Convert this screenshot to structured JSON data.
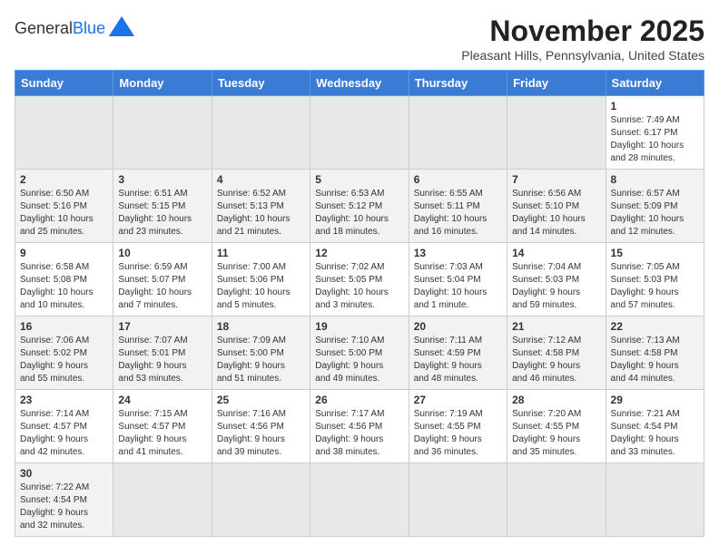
{
  "header": {
    "logo_general": "General",
    "logo_blue": "Blue",
    "month_year": "November 2025",
    "location": "Pleasant Hills, Pennsylvania, United States"
  },
  "days_of_week": [
    "Sunday",
    "Monday",
    "Tuesday",
    "Wednesday",
    "Thursday",
    "Friday",
    "Saturday"
  ],
  "weeks": [
    [
      {
        "day": "",
        "text": ""
      },
      {
        "day": "",
        "text": ""
      },
      {
        "day": "",
        "text": ""
      },
      {
        "day": "",
        "text": ""
      },
      {
        "day": "",
        "text": ""
      },
      {
        "day": "",
        "text": ""
      },
      {
        "day": "1",
        "text": "Sunrise: 7:49 AM\nSunset: 6:17 PM\nDaylight: 10 hours\nand 28 minutes."
      }
    ],
    [
      {
        "day": "2",
        "text": "Sunrise: 6:50 AM\nSunset: 5:16 PM\nDaylight: 10 hours\nand 25 minutes."
      },
      {
        "day": "3",
        "text": "Sunrise: 6:51 AM\nSunset: 5:15 PM\nDaylight: 10 hours\nand 23 minutes."
      },
      {
        "day": "4",
        "text": "Sunrise: 6:52 AM\nSunset: 5:13 PM\nDaylight: 10 hours\nand 21 minutes."
      },
      {
        "day": "5",
        "text": "Sunrise: 6:53 AM\nSunset: 5:12 PM\nDaylight: 10 hours\nand 18 minutes."
      },
      {
        "day": "6",
        "text": "Sunrise: 6:55 AM\nSunset: 5:11 PM\nDaylight: 10 hours\nand 16 minutes."
      },
      {
        "day": "7",
        "text": "Sunrise: 6:56 AM\nSunset: 5:10 PM\nDaylight: 10 hours\nand 14 minutes."
      },
      {
        "day": "8",
        "text": "Sunrise: 6:57 AM\nSunset: 5:09 PM\nDaylight: 10 hours\nand 12 minutes."
      }
    ],
    [
      {
        "day": "9",
        "text": "Sunrise: 6:58 AM\nSunset: 5:08 PM\nDaylight: 10 hours\nand 10 minutes."
      },
      {
        "day": "10",
        "text": "Sunrise: 6:59 AM\nSunset: 5:07 PM\nDaylight: 10 hours\nand 7 minutes."
      },
      {
        "day": "11",
        "text": "Sunrise: 7:00 AM\nSunset: 5:06 PM\nDaylight: 10 hours\nand 5 minutes."
      },
      {
        "day": "12",
        "text": "Sunrise: 7:02 AM\nSunset: 5:05 PM\nDaylight: 10 hours\nand 3 minutes."
      },
      {
        "day": "13",
        "text": "Sunrise: 7:03 AM\nSunset: 5:04 PM\nDaylight: 10 hours\nand 1 minute."
      },
      {
        "day": "14",
        "text": "Sunrise: 7:04 AM\nSunset: 5:03 PM\nDaylight: 9 hours\nand 59 minutes."
      },
      {
        "day": "15",
        "text": "Sunrise: 7:05 AM\nSunset: 5:03 PM\nDaylight: 9 hours\nand 57 minutes."
      }
    ],
    [
      {
        "day": "16",
        "text": "Sunrise: 7:06 AM\nSunset: 5:02 PM\nDaylight: 9 hours\nand 55 minutes."
      },
      {
        "day": "17",
        "text": "Sunrise: 7:07 AM\nSunset: 5:01 PM\nDaylight: 9 hours\nand 53 minutes."
      },
      {
        "day": "18",
        "text": "Sunrise: 7:09 AM\nSunset: 5:00 PM\nDaylight: 9 hours\nand 51 minutes."
      },
      {
        "day": "19",
        "text": "Sunrise: 7:10 AM\nSunset: 5:00 PM\nDaylight: 9 hours\nand 49 minutes."
      },
      {
        "day": "20",
        "text": "Sunrise: 7:11 AM\nSunset: 4:59 PM\nDaylight: 9 hours\nand 48 minutes."
      },
      {
        "day": "21",
        "text": "Sunrise: 7:12 AM\nSunset: 4:58 PM\nDaylight: 9 hours\nand 46 minutes."
      },
      {
        "day": "22",
        "text": "Sunrise: 7:13 AM\nSunset: 4:58 PM\nDaylight: 9 hours\nand 44 minutes."
      }
    ],
    [
      {
        "day": "23",
        "text": "Sunrise: 7:14 AM\nSunset: 4:57 PM\nDaylight: 9 hours\nand 42 minutes."
      },
      {
        "day": "24",
        "text": "Sunrise: 7:15 AM\nSunset: 4:57 PM\nDaylight: 9 hours\nand 41 minutes."
      },
      {
        "day": "25",
        "text": "Sunrise: 7:16 AM\nSunset: 4:56 PM\nDaylight: 9 hours\nand 39 minutes."
      },
      {
        "day": "26",
        "text": "Sunrise: 7:17 AM\nSunset: 4:56 PM\nDaylight: 9 hours\nand 38 minutes."
      },
      {
        "day": "27",
        "text": "Sunrise: 7:19 AM\nSunset: 4:55 PM\nDaylight: 9 hours\nand 36 minutes."
      },
      {
        "day": "28",
        "text": "Sunrise: 7:20 AM\nSunset: 4:55 PM\nDaylight: 9 hours\nand 35 minutes."
      },
      {
        "day": "29",
        "text": "Sunrise: 7:21 AM\nSunset: 4:54 PM\nDaylight: 9 hours\nand 33 minutes."
      }
    ],
    [
      {
        "day": "30",
        "text": "Sunrise: 7:22 AM\nSunset: 4:54 PM\nDaylight: 9 hours\nand 32 minutes."
      },
      {
        "day": "",
        "text": ""
      },
      {
        "day": "",
        "text": ""
      },
      {
        "day": "",
        "text": ""
      },
      {
        "day": "",
        "text": ""
      },
      {
        "day": "",
        "text": ""
      },
      {
        "day": "",
        "text": ""
      }
    ]
  ]
}
